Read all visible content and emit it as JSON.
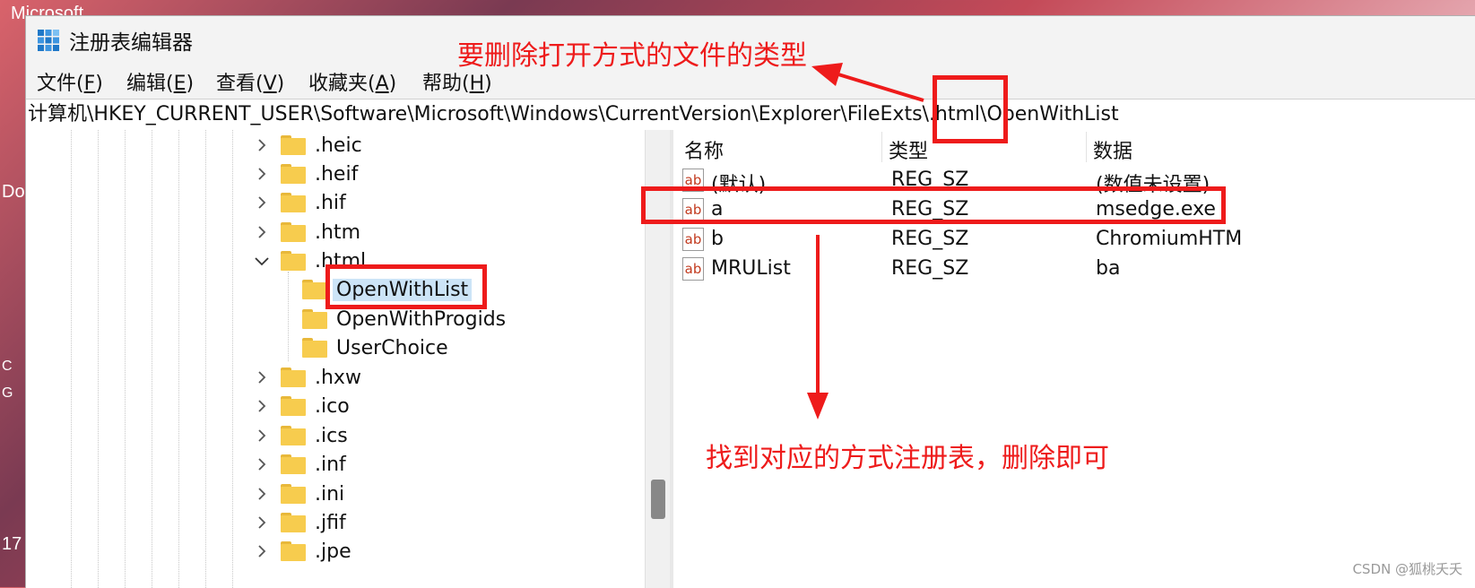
{
  "desktop": {
    "top_text": "Microsoft",
    "left_text_1": "Do",
    "left_text_2": "17",
    "left_text_3": "C",
    "left_text_4": "G"
  },
  "window": {
    "title": "注册表编辑器",
    "app_icon": "regedit-icon"
  },
  "menu": [
    {
      "text": "文件(",
      "key": "F",
      "end": ")"
    },
    {
      "text": "编辑(",
      "key": "E",
      "end": ")"
    },
    {
      "text": "查看(",
      "key": "V",
      "end": ")"
    },
    {
      "text": "收藏夹(",
      "key": "A",
      "end": ")"
    },
    {
      "text": "帮助(",
      "key": "H",
      "end": ")"
    }
  ],
  "address": "计算机\\HKEY_CURRENT_USER\\Software\\Microsoft\\Windows\\CurrentVersion\\Explorer\\FileExts\\.html\\OpenWithList",
  "tree": [
    {
      "label": ".heic",
      "expanded": false
    },
    {
      "label": ".heif",
      "expanded": false
    },
    {
      "label": ".hif",
      "expanded": false
    },
    {
      "label": ".htm",
      "expanded": false
    },
    {
      "label": ".html",
      "expanded": true
    },
    {
      "label": "OpenWithList",
      "child": true,
      "selected": true
    },
    {
      "label": "OpenWithProgids",
      "child": true
    },
    {
      "label": "UserChoice",
      "child": true
    },
    {
      "label": ".hxw",
      "expanded": false
    },
    {
      "label": ".ico",
      "expanded": false
    },
    {
      "label": ".ics",
      "expanded": false
    },
    {
      "label": ".inf",
      "expanded": false
    },
    {
      "label": ".ini",
      "expanded": false
    },
    {
      "label": ".jfif",
      "expanded": false
    },
    {
      "label": ".jpe",
      "expanded": false
    }
  ],
  "columns": {
    "name": "名称",
    "type": "类型",
    "data": "数据"
  },
  "values": [
    {
      "name": "(默认)",
      "type": "REG_SZ",
      "data": "(数值未设置)"
    },
    {
      "name": "a",
      "type": "REG_SZ",
      "data": "msedge.exe"
    },
    {
      "name": "b",
      "type": "REG_SZ",
      "data": "ChromiumHTM"
    },
    {
      "name": "MRUList",
      "type": "REG_SZ",
      "data": "ba"
    }
  ],
  "annotations": {
    "top_note": "要删除打开方式的文件的类型",
    "bottom_note": "找到对应的方式注册表，删除即可",
    "color": "#ee1b1b"
  },
  "watermark": "CSDN @狐桃夭夭"
}
